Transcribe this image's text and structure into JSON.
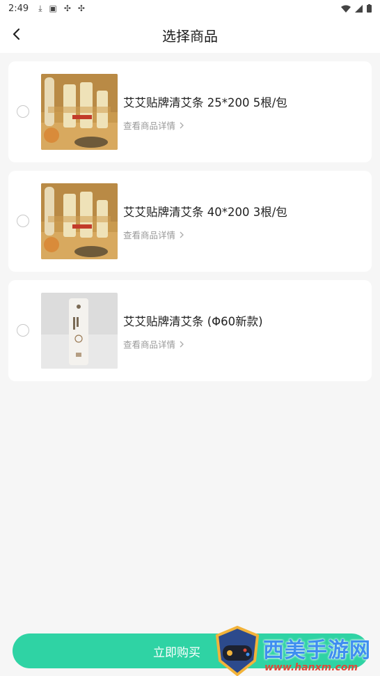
{
  "status_bar": {
    "time": "2:49",
    "icons": [
      "download-icon",
      "a-icon",
      "bug-icon",
      "bug-icon"
    ]
  },
  "header": {
    "title": "选择商品"
  },
  "products": [
    {
      "name": "艾艾贴牌清艾条 25*200 5根/包",
      "detail_link": "查看商品详情"
    },
    {
      "name": "艾艾贴牌清艾条 40*200 3根/包",
      "detail_link": "查看商品详情"
    },
    {
      "name": "艾艾贴牌清艾条 (Φ60新款)",
      "detail_link": "查看商品详情"
    }
  ],
  "footer": {
    "buy_label": "立即购买"
  },
  "watermark": {
    "name": "西美手游网",
    "url": "www.hanxm.com"
  },
  "colors": {
    "accent": "#2fd3a4",
    "background": "#f6f6f6"
  }
}
